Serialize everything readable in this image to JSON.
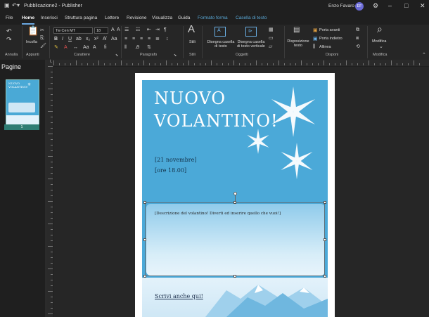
{
  "window": {
    "title": "Pubblicazione2 - Publisher",
    "user_name": "Enzo Favaro",
    "user_initials": "EF"
  },
  "tabs": [
    "File",
    "Home",
    "Inserisci",
    "Struttura pagina",
    "Lettere",
    "Revisione",
    "Visualizza",
    "Guida",
    "Formato forma",
    "Casella di testo"
  ],
  "active_tab": "Home",
  "ribbon": {
    "groups": {
      "annulla": "Annulla",
      "appunti": "Appunti",
      "carattere": "Carattere",
      "paragrafo": "Paragrafo",
      "stili": "Stili",
      "oggetti": "Oggetti",
      "disponi": "Disponi",
      "modifica": "Modifica"
    },
    "incolla": "Incolla",
    "font_name": "Tw Cen MT",
    "font_size": "18",
    "stili_label": "Stili",
    "disegna_testo": "Disegna casella di testo",
    "disegna_verticale": "Disegna casella di testo verticale",
    "disposizione_testo": "Disposizione testo",
    "porta_avanti": "Porta avanti",
    "porta_indietro": "Porta indietro",
    "allinea": "Allinea",
    "modifica_label": "Modifica"
  },
  "pages_panel": {
    "title": "Pagine",
    "page_number": "1"
  },
  "flyer": {
    "title_line1": "NUOVO",
    "title_line2": "VOLANTINO!",
    "date": "[21 novembre]",
    "time": "[ore 18.00]",
    "description": "[Descrizione del volantino! Diverti ed inserire quello che vuoi!]",
    "bottom_text": "Scrivi anche qui!",
    "background_color": "#4ba9d8"
  }
}
